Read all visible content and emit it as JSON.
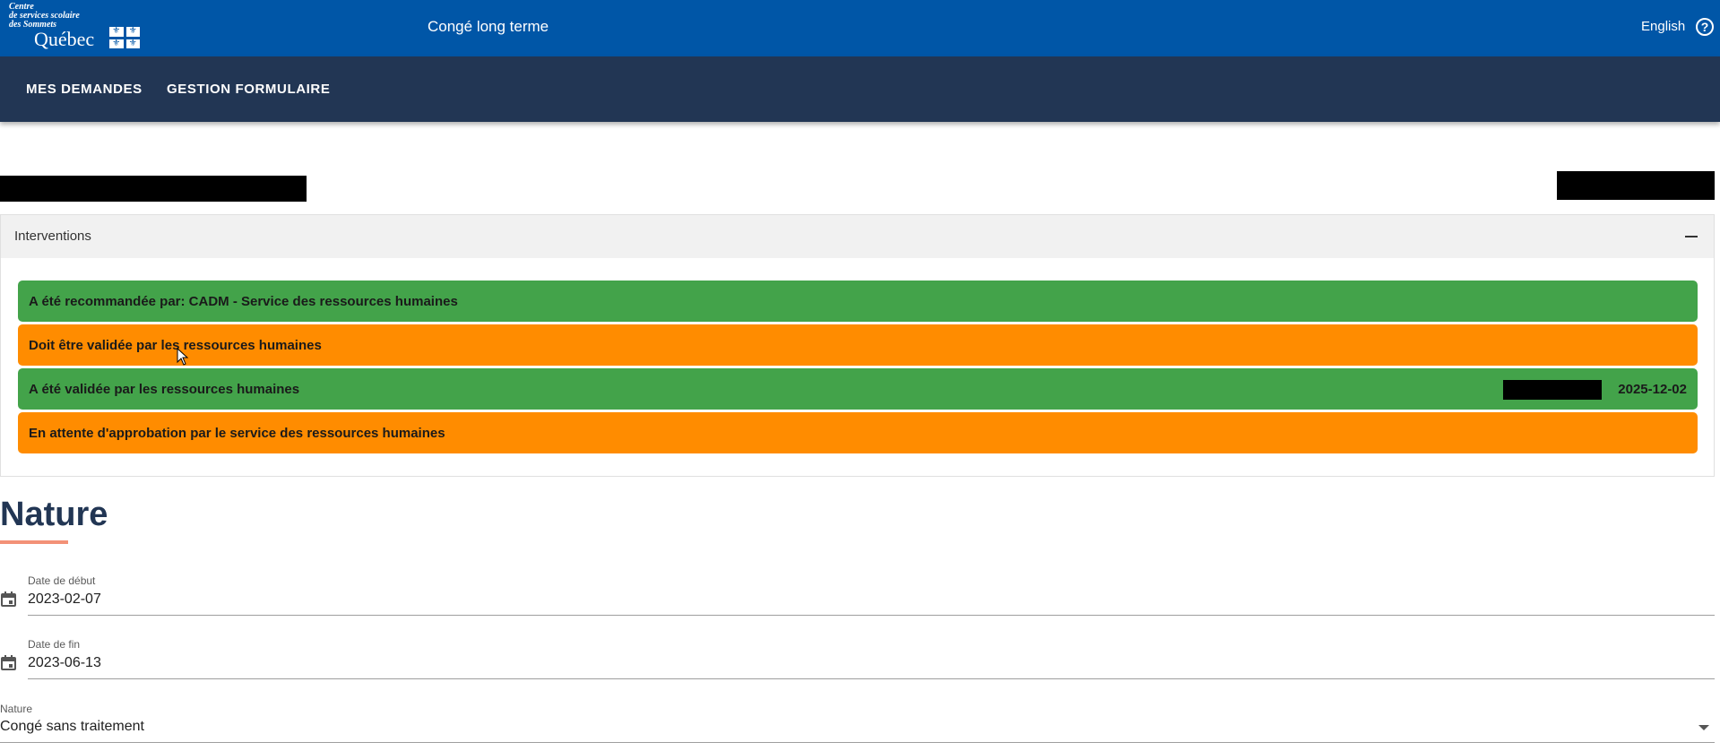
{
  "header": {
    "logo_org": "Centre\nde services scolaire\ndes Sommets",
    "logo_province": "Québec",
    "app_title": "Congé long terme",
    "language_link": "English",
    "help_icon": "help-circle-icon"
  },
  "nav": {
    "items": [
      {
        "label": "MES DEMANDES"
      },
      {
        "label": "GESTION FORMULAIRE"
      }
    ]
  },
  "interventions": {
    "title": "Interventions",
    "collapse_icon": "minus-icon",
    "rows": [
      {
        "text": "A été recommandée par: CADM - Service des ressources humaines",
        "status": "green",
        "date": ""
      },
      {
        "text": "Doit être validée par les ressources humaines",
        "status": "orange",
        "date": ""
      },
      {
        "text": "A été validée par les ressources humaines",
        "status": "green",
        "date": "2025-12-02"
      },
      {
        "text": "En attente d'approbation par le service des ressources humaines",
        "status": "orange",
        "date": ""
      }
    ]
  },
  "nature_section": {
    "title": "Nature",
    "fields": {
      "start_date": {
        "label": "Date de début",
        "value": "2023-02-07",
        "icon": "calendar-icon"
      },
      "end_date": {
        "label": "Date de fin",
        "value": "2023-06-13",
        "icon": "calendar-icon"
      },
      "nature": {
        "label": "Nature",
        "value": "Congé sans traitement",
        "icon": "chevron-down-icon"
      }
    }
  },
  "colors": {
    "header_blue": "#0056a7",
    "nav_navy": "#223654",
    "status_green": "#43a34a",
    "status_orange": "#ff8c00",
    "accent_salmon": "#f39177"
  }
}
